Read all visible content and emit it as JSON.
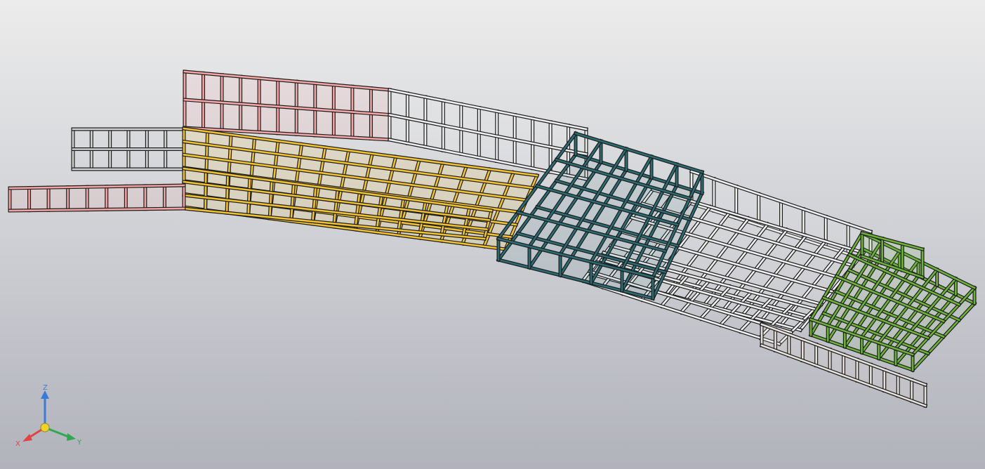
{
  "viewport": {
    "background_top": "#ececec",
    "background_bottom": "#b1b2bb"
  },
  "frames": [
    {
      "id": "red-low-rail",
      "color": "#f4a3a3"
    },
    {
      "id": "dark-side-box",
      "color": "#d2d2d2"
    },
    {
      "id": "red-upper-wall",
      "color": "#f6a6a6"
    },
    {
      "id": "white-upper-wall",
      "color": "#efefef"
    },
    {
      "id": "yellow-floor-grid",
      "color": "#f2c231"
    },
    {
      "id": "teal-module",
      "color": "#2b6b73"
    },
    {
      "id": "white-floor-grid",
      "color": "#f0f0f0"
    },
    {
      "id": "green-module",
      "color": "#6db33a"
    },
    {
      "id": "beige-tail-rail",
      "color": "#e8e2dc"
    }
  ],
  "triad": {
    "x_label": "X",
    "y_label": "Y",
    "z_label": "Z",
    "x_color": "#e04545",
    "y_color": "#2fa84f",
    "z_color": "#3b7bd8",
    "origin_color": "#f2d22a"
  }
}
